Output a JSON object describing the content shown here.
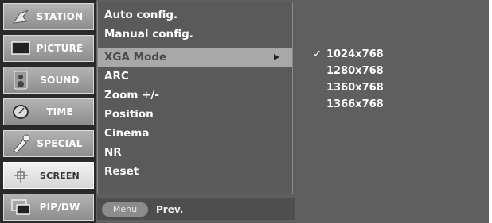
{
  "categories": [
    {
      "label": "STATION",
      "icon": "antenna-icon"
    },
    {
      "label": "PICTURE",
      "icon": "monitor-icon"
    },
    {
      "label": "SOUND",
      "icon": "speaker-icon"
    },
    {
      "label": "TIME",
      "icon": "clock-icon"
    },
    {
      "label": "SPECIAL",
      "icon": "remote-icon"
    },
    {
      "label": "SCREEN",
      "icon": "screen-adjust-icon",
      "active": true
    },
    {
      "label": "PIP/DW",
      "icon": "pip-icon"
    }
  ],
  "menu": {
    "items": [
      {
        "label": "Auto config."
      },
      {
        "label": "Manual config."
      },
      {
        "label": "XGA Mode",
        "selected": true,
        "has_submenu": true
      },
      {
        "label": "ARC"
      },
      {
        "label": "Zoom +/-"
      },
      {
        "label": "Position"
      },
      {
        "label": "Cinema"
      },
      {
        "label": "NR"
      },
      {
        "label": "Reset"
      }
    ],
    "footer": {
      "button_label": "Menu",
      "prev_label": "Prev."
    }
  },
  "submenu": {
    "items": [
      {
        "label": "1024x768",
        "checked": true,
        "check": "✓"
      },
      {
        "label": "1280x768",
        "checked": false,
        "check": ""
      },
      {
        "label": "1360x768",
        "checked": false,
        "check": ""
      },
      {
        "label": "1366x768",
        "checked": false,
        "check": ""
      }
    ]
  },
  "colors": {
    "menu_bg": "#5f5f5f",
    "highlight": "#a8a8a8",
    "text": "#ffffff"
  }
}
